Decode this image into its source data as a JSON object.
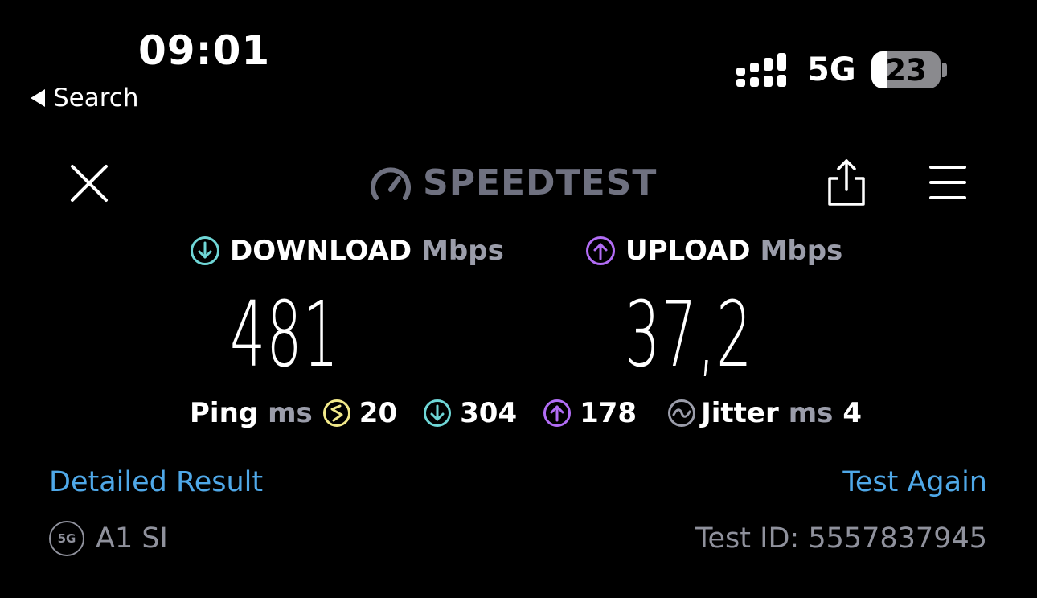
{
  "status_bar": {
    "time": "09:01",
    "back_label": "Search",
    "network": "5G",
    "battery": "23",
    "battery_level_percent": 23,
    "icons": [
      "signal-icon",
      "battery-icon"
    ]
  },
  "header": {
    "logo_text": "SPEEDTEST",
    "icons": [
      "close-icon",
      "speedometer-icon",
      "share-icon",
      "menu-icon"
    ]
  },
  "download": {
    "label": "DOWNLOAD",
    "unit": "Mbps",
    "value": "481",
    "color": "#6fd6d6"
  },
  "upload": {
    "label": "UPLOAD",
    "unit": "Mbps",
    "value": "37,2",
    "color": "#b26df5"
  },
  "metrics": {
    "ping_label": "Ping",
    "ping_unit": "ms",
    "ping_idle": "20",
    "ping_download": "304",
    "ping_upload": "178",
    "jitter_label": "Jitter",
    "jitter_unit": "ms",
    "jitter_value": "4",
    "ping_color": "#f2e98a"
  },
  "links": {
    "detailed": "Detailed Result",
    "again": "Test Again",
    "color": "#4fa8e8"
  },
  "footer": {
    "carrier_badge": "5G",
    "carrier": "A1 SI",
    "test_id": "Test ID: 5557837945"
  }
}
